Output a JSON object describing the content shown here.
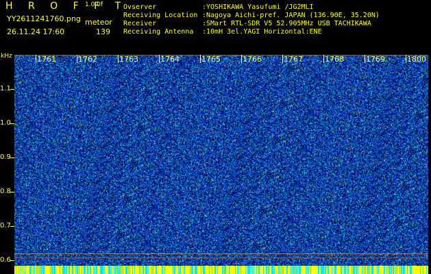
{
  "header": {
    "brand": "H R O F F T",
    "version": "1.0.0f",
    "filename": "YY2611241760.png",
    "kind": "meteor",
    "datetime": "26.11.24 17:60",
    "count": "139"
  },
  "info": [
    {
      "key": "Ovserver",
      "value": ":YOSHIKAWA Yasufumi /JG2MLI"
    },
    {
      "key": "Receiving Location",
      "value": ":Nagoya Aichi-pref. JAPAN (136.90E, 35.20N)"
    },
    {
      "key": "Receiver",
      "value": ":SMart RTL-SDR V5 52.905MHz USB TACHIKAWA"
    },
    {
      "key": "Receiving Antenna",
      "value": ":10mH 3el.YAGI Horizontal:ENE"
    }
  ],
  "axis": {
    "unit": "kHz",
    "y_ticks": [
      "1.1",
      "1.0",
      "0.9",
      "0.8",
      "0.7",
      "0.6"
    ],
    "minutes": [
      "1761",
      "1762",
      "1763",
      "1764",
      "1765",
      "1766",
      "1767",
      "1768",
      "1769",
      "1800"
    ]
  },
  "colors": {
    "label": "#ffff33",
    "noise_base": "#0a1a88",
    "strip_a": "#ffff00",
    "strip_b": "#00e5ff"
  }
}
